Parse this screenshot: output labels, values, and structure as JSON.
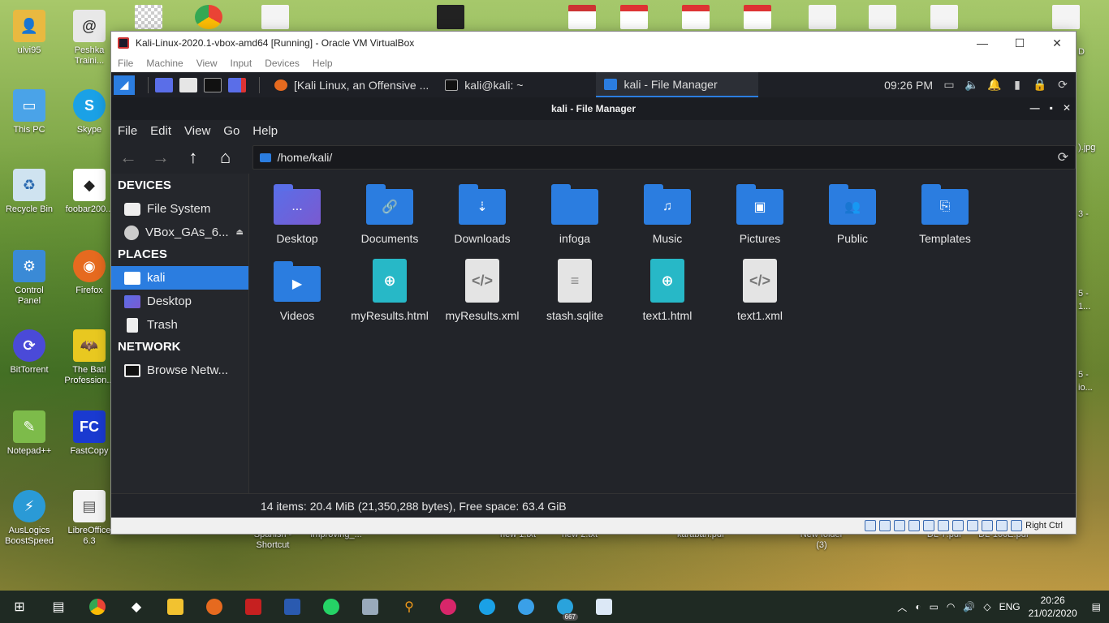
{
  "desktop": {
    "icons": [
      {
        "label": "ulvi95",
        "icon": "user-folder-icon",
        "color": "#e9b940"
      },
      {
        "label": "Peshka Traini...",
        "icon": "shortcut-icon",
        "color": "#e8e8e8"
      },
      {
        "label": "This PC",
        "icon": "computer-icon",
        "color": "#4aa3e8"
      },
      {
        "label": "Skype",
        "icon": "skype-icon",
        "color": "#1aa1e6"
      },
      {
        "label": "Recycle Bin",
        "icon": "recycle-bin-icon",
        "color": "#cfe3f0"
      },
      {
        "label": "foobar200...",
        "icon": "foobar-icon",
        "color": "#222222"
      },
      {
        "label": "Control Panel",
        "icon": "control-panel-icon",
        "color": "#3a8ad6"
      },
      {
        "label": "Firefox",
        "icon": "firefox-icon",
        "color": "#e66a1f"
      },
      {
        "label": "BitTorrent",
        "icon": "bittorrent-icon",
        "color": "#4a4ad8"
      },
      {
        "label": "The Bat! Profession...",
        "icon": "thebat-icon",
        "color": "#e8c820"
      },
      {
        "label": "Notepad++",
        "icon": "notepad-plus-icon",
        "color": "#7dbb4a"
      },
      {
        "label": "FastCopy",
        "icon": "fastcopy-icon",
        "color": "#1a3ad0"
      },
      {
        "label": "AusLogics BoostSpeed",
        "icon": "auslogics-icon",
        "color": "#2a9ad6"
      },
      {
        "label": "LibreOffice 6.3",
        "icon": "libreoffice-icon",
        "color": "#f2f2f2"
      }
    ],
    "bottom_labels": [
      "Spanish - Shortcut",
      "Improving_...",
      "new 1.txt",
      "new 2.txt",
      "karaban.pdf",
      "New folder (3)",
      "DL-7.pdf",
      "DL-100E.pdf"
    ],
    "right_labels": [
      ").jpg",
      "3 -",
      "5 -",
      "1...",
      "5 -",
      "io...",
      "D"
    ]
  },
  "vbox": {
    "title": "Kali-Linux-2020.1-vbox-amd64 [Running] - Oracle VM VirtualBox",
    "menu": [
      "File",
      "Machine",
      "View",
      "Input",
      "Devices",
      "Help"
    ],
    "status_key": "Right Ctrl",
    "controls": {
      "minimize": "—",
      "maximize": "☐",
      "close": "✕"
    }
  },
  "kali_panel": {
    "tasks": [
      {
        "label": "[Kali Linux, an Offensive ...",
        "icon": "firefox-icon",
        "active": false
      },
      {
        "label": "kali@kali: ~",
        "icon": "terminal-icon",
        "active": false
      },
      {
        "label": "kali - File Manager",
        "icon": "folder-icon",
        "active": true
      }
    ],
    "clock": "09:26 PM"
  },
  "file_manager": {
    "title": "kali - File Manager",
    "menu": [
      "File",
      "Edit",
      "View",
      "Go",
      "Help"
    ],
    "path": "/home/kali/",
    "sidebar": {
      "devices_heading": "DEVICES",
      "devices": [
        {
          "label": "File System",
          "icon": "harddisk-icon"
        },
        {
          "label": "VBox_GAs_6...",
          "icon": "optical-disc-icon"
        }
      ],
      "places_heading": "PLACES",
      "places": [
        {
          "label": "kali",
          "icon": "home-folder-icon",
          "selected": true
        },
        {
          "label": "Desktop",
          "icon": "desktop-icon",
          "selected": false
        },
        {
          "label": "Trash",
          "icon": "trash-icon",
          "selected": false
        }
      ],
      "network_heading": "NETWORK",
      "network": [
        {
          "label": "Browse Netw...",
          "icon": "network-icon"
        }
      ]
    },
    "files": [
      {
        "name": "Desktop",
        "kind": "folder-desktop",
        "glyph": "..."
      },
      {
        "name": "Documents",
        "kind": "folder",
        "glyph": "🔗"
      },
      {
        "name": "Downloads",
        "kind": "folder",
        "glyph": "⇣"
      },
      {
        "name": "infoga",
        "kind": "folder",
        "glyph": ""
      },
      {
        "name": "Music",
        "kind": "folder",
        "glyph": "♫"
      },
      {
        "name": "Pictures",
        "kind": "folder",
        "glyph": "▣"
      },
      {
        "name": "Public",
        "kind": "folder",
        "glyph": "👥"
      },
      {
        "name": "Templates",
        "kind": "folder",
        "glyph": "⎘"
      },
      {
        "name": "Videos",
        "kind": "folder",
        "glyph": "▶"
      },
      {
        "name": "myResults.html",
        "kind": "html",
        "glyph": "⊕"
      },
      {
        "name": "myResults.xml",
        "kind": "xml",
        "glyph": "</>"
      },
      {
        "name": "stash.sqlite",
        "kind": "sql",
        "glyph": "≡"
      },
      {
        "name": "text1.html",
        "kind": "html",
        "glyph": "⊕"
      },
      {
        "name": "text1.xml",
        "kind": "xml",
        "glyph": "</>"
      }
    ],
    "status": "14 items: 20.4 MiB (21,350,288 bytes), Free space: 63.4 GiB"
  },
  "taskbar": {
    "apps": [
      "start-icon",
      "task-view-icon",
      "chrome-icon",
      "foobar-icon",
      "file-explorer-icon",
      "firefox-icon",
      "acrobat-icon",
      "virtualbox-icon",
      "whatsapp-icon",
      "image-viewer-icon",
      "search-app-icon",
      "kali-icon",
      "skype-icon",
      "vpn-icon",
      "telegram-icon",
      "notes-icon"
    ],
    "telegram_badge": "667",
    "language": "ENG",
    "time": "20:26",
    "date": "21/02/2020"
  }
}
